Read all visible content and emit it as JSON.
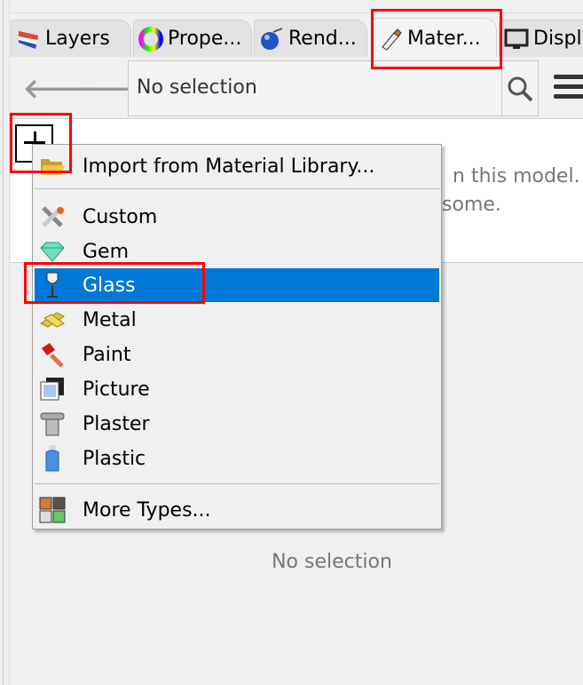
{
  "tabs": [
    {
      "label": "Layers",
      "icon": "layers-icon"
    },
    {
      "label": "Prope...",
      "icon": "properties-icon"
    },
    {
      "label": "Rend...",
      "icon": "rendering-icon"
    },
    {
      "label": "Mater...",
      "icon": "materials-icon",
      "active": true
    },
    {
      "label": "Displ",
      "icon": "display-icon"
    }
  ],
  "toolbar": {
    "search_value": "No selection"
  },
  "content": {
    "msg_line1": "n this model.",
    "msg_line2": "some."
  },
  "menu": {
    "items": [
      {
        "label": "Import from Material Library...",
        "icon": "folder-icon"
      },
      {
        "label": "Custom",
        "icon": "tools-icon"
      },
      {
        "label": "Gem",
        "icon": "gem-icon"
      },
      {
        "label": "Glass",
        "icon": "wine-glass-icon",
        "selected": true
      },
      {
        "label": "Metal",
        "icon": "metal-bar-icon"
      },
      {
        "label": "Paint",
        "icon": "paint-roller-icon"
      },
      {
        "label": "Picture",
        "icon": "picture-icon"
      },
      {
        "label": "Plaster",
        "icon": "column-icon"
      },
      {
        "label": "Plastic",
        "icon": "bottle-icon"
      },
      {
        "label": "More Types...",
        "icon": "grid-icon"
      }
    ]
  },
  "footer": {
    "no_selection": "No selection"
  },
  "colors": {
    "highlight": "#0078d7",
    "annotation": "#ff0000"
  }
}
